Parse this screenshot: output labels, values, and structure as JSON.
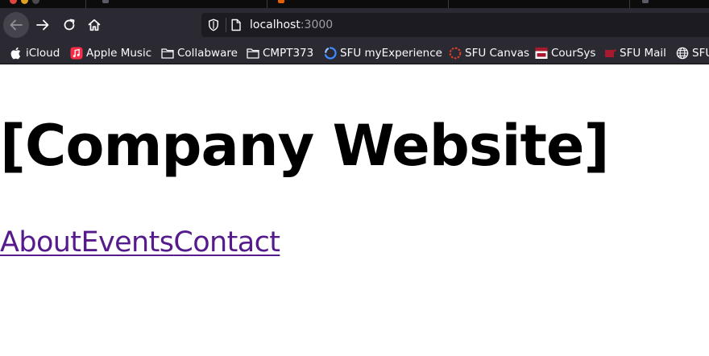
{
  "browser": {
    "url_host": "localhost",
    "url_port": ":3000"
  },
  "bookmarks": [
    {
      "label": "iCloud",
      "icon": "apple-icon"
    },
    {
      "label": "Apple Music",
      "icon": "apple-music-icon"
    },
    {
      "label": "Collabware",
      "icon": "folder-icon"
    },
    {
      "label": "CMPT373",
      "icon": "folder-icon"
    },
    {
      "label": "SFU myExperience",
      "icon": "myexperience-icon"
    },
    {
      "label": "SFU Canvas",
      "icon": "canvas-icon"
    },
    {
      "label": "CourSys",
      "icon": "sfu-logo-icon"
    },
    {
      "label": "SFU Mail",
      "icon": "sfu-mail-icon"
    },
    {
      "label": "SFU",
      "icon": "globe-icon"
    }
  ],
  "page": {
    "title": "[Company Website]",
    "links": [
      "About",
      "Events",
      "Contact"
    ]
  },
  "colors": {
    "chrome_bg": "#2b2a33",
    "urlbar_bg": "#1c1b22",
    "visited_link": "#551a8b"
  }
}
